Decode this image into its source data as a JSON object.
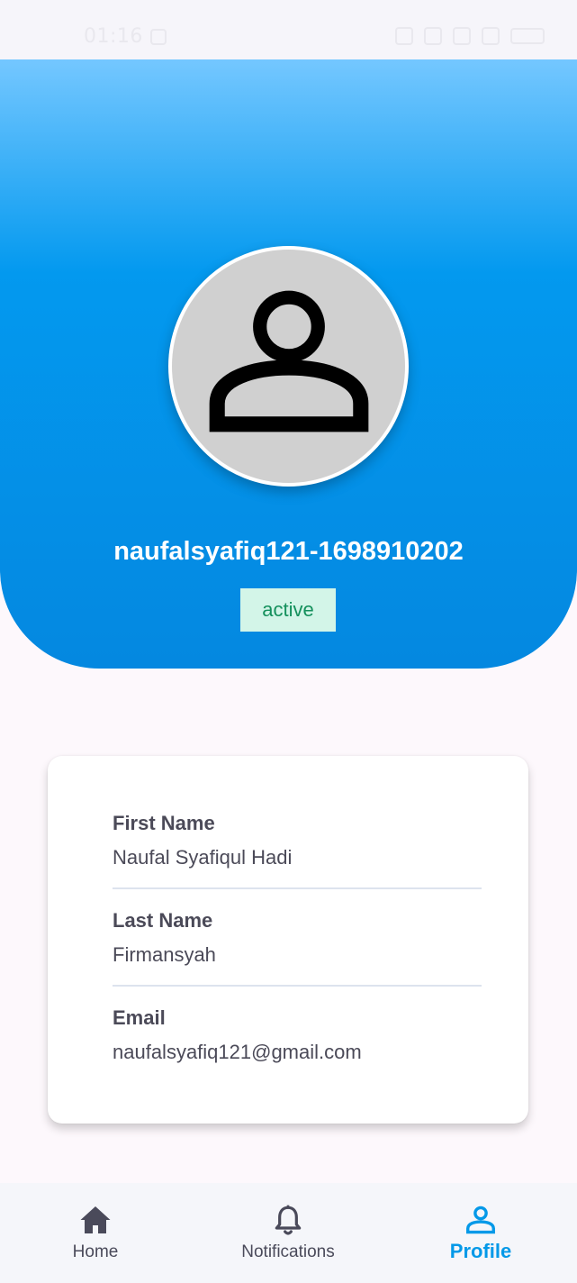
{
  "status_bar": {
    "time": "01:16"
  },
  "profile": {
    "username": "naufalsyafiq121-1698910202",
    "status": "active",
    "avatar_icon": "person-icon"
  },
  "details": {
    "first_name_label": "First Name",
    "first_name_value": "Naufal Syafiqul Hadi",
    "last_name_label": "Last Name",
    "last_name_value": "Firmansyah",
    "email_label": "Email",
    "email_value": "naufalsyafiq121@gmail.com"
  },
  "bottom_nav": {
    "items": [
      {
        "label": "Home",
        "icon": "home-icon",
        "active": false
      },
      {
        "label": "Notifications",
        "icon": "bell-icon",
        "active": false
      },
      {
        "label": "Profile",
        "icon": "person-icon",
        "active": true
      }
    ]
  },
  "colors": {
    "accent": "#0499e8",
    "header_top": "#74c7ff",
    "header_bottom": "#0488e0",
    "badge_bg": "#d3f5e8",
    "badge_text": "#14905c"
  }
}
